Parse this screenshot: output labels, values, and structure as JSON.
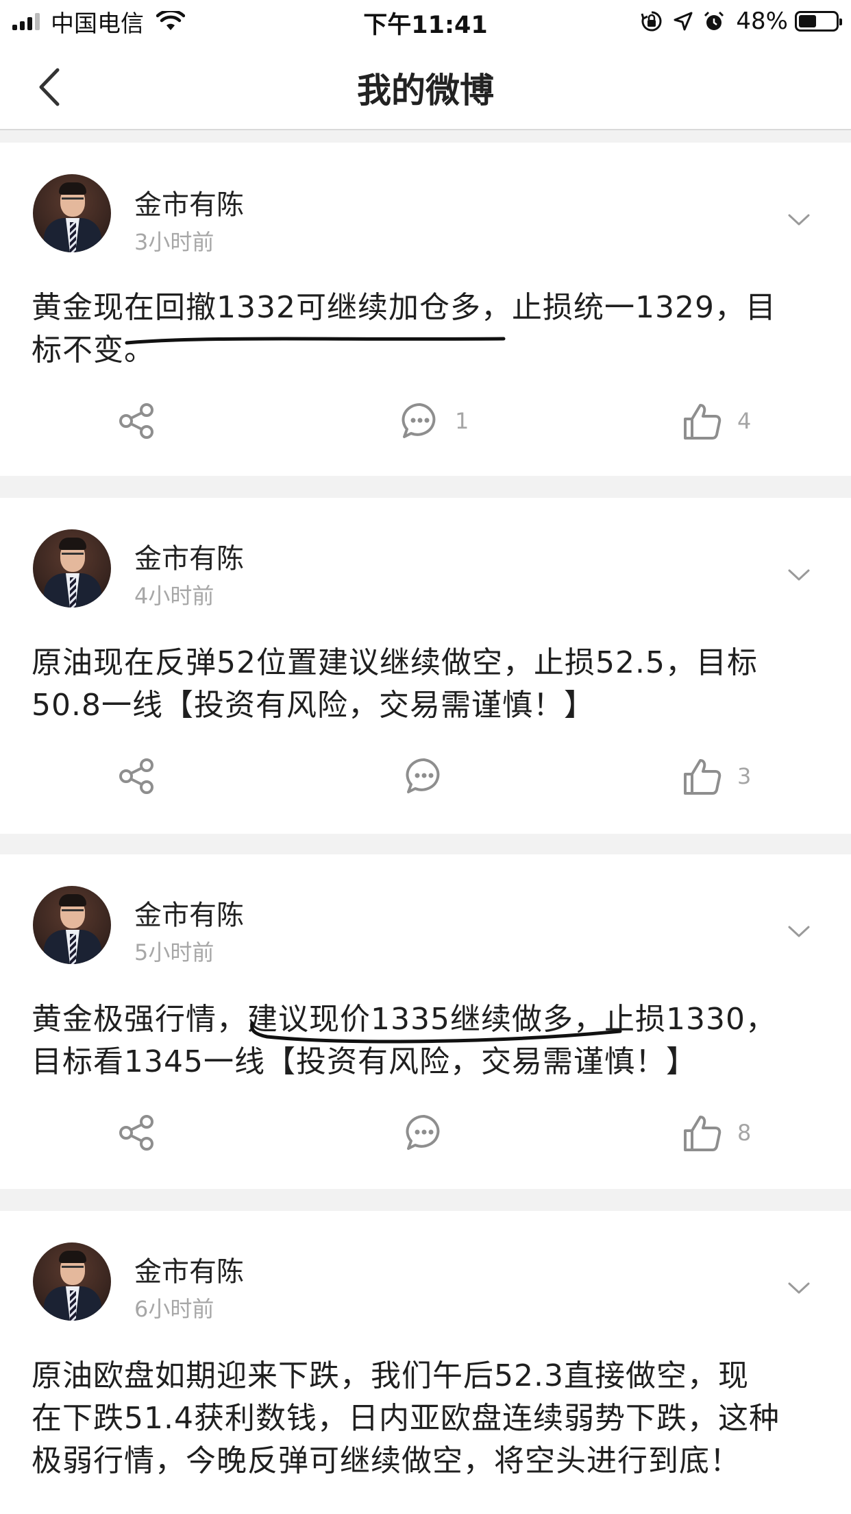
{
  "status_bar": {
    "carrier": "中国电信",
    "time": "下午11:41",
    "battery_percent": "48%",
    "battery_level": 0.48
  },
  "nav": {
    "title": "我的微博"
  },
  "posts": [
    {
      "author": "金市有陈",
      "time": "3小时前",
      "content_lines": [
        "黄金现在回撤1332可继续加仓多，止损统一1329，目",
        "标不变。"
      ],
      "comments": "1",
      "likes": "4"
    },
    {
      "author": "金市有陈",
      "time": "4小时前",
      "content_lines": [
        "原油现在反弹52位置建议继续做空，止损52.5，目标",
        "50.8一线【投资有风险，交易需谨慎！】"
      ],
      "comments": "",
      "likes": "3"
    },
    {
      "author": "金市有陈",
      "time": "5小时前",
      "content_lines": [
        "黄金极强行情，建议现价1335继续做多，止损1330，",
        "目标看1345一线【投资有风险，交易需谨慎！】"
      ],
      "comments": "",
      "likes": "8"
    },
    {
      "author": "金市有陈",
      "time": "6小时前",
      "content_lines": [
        "原油欧盘如期迎来下跌，我们午后52.3直接做空，现",
        "在下跌51.4获利数钱，日内亚欧盘连续弱势下跌，这种",
        "极弱行情，今晚反弹可继续做空，将空头进行到底！"
      ],
      "comments": "",
      "likes": ""
    }
  ],
  "colors": {
    "background": "#f2f2f2",
    "card": "#ffffff",
    "text": "#1f1f1f",
    "muted": "#a7a7a7",
    "icon": "#8e8e8e"
  },
  "icons": [
    "back-icon",
    "share-icon",
    "comment-icon",
    "like-icon",
    "chevron-down-icon",
    "wifi-icon",
    "orientation-lock-icon",
    "location-icon",
    "alarm-icon",
    "battery-icon"
  ]
}
